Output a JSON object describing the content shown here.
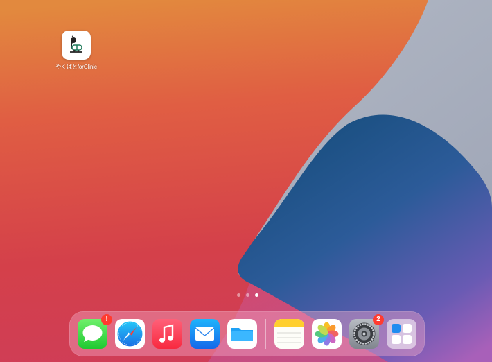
{
  "home_screen": {
    "apps": [
      {
        "label": "やくばとforClinic",
        "icon": "yakubato-icon",
        "accent": "#1e7a5a"
      }
    ],
    "page_count": 3,
    "active_page": 3
  },
  "dock": {
    "apps": [
      {
        "name": "Messages",
        "icon": "messages-icon",
        "badge": "!"
      },
      {
        "name": "Safari",
        "icon": "safari-icon",
        "badge": ""
      },
      {
        "name": "Music",
        "icon": "music-icon",
        "badge": ""
      },
      {
        "name": "Mail",
        "icon": "mail-icon",
        "badge": ""
      },
      {
        "name": "Files",
        "icon": "files-icon",
        "badge": ""
      },
      {
        "name": "Notes",
        "icon": "notes-icon",
        "badge": ""
      },
      {
        "name": "Photos",
        "icon": "photos-icon",
        "badge": ""
      },
      {
        "name": "Settings",
        "icon": "settings-icon",
        "badge": "2"
      },
      {
        "name": "App Library",
        "icon": "app-library-icon",
        "badge": ""
      }
    ]
  }
}
